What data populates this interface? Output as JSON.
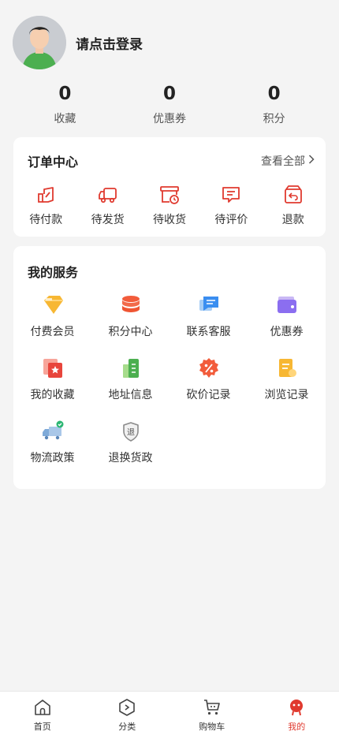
{
  "profile": {
    "login_text": "请点击登录"
  },
  "stats": [
    {
      "value": "0",
      "label": "收藏"
    },
    {
      "value": "0",
      "label": "优惠券"
    },
    {
      "value": "0",
      "label": "积分"
    }
  ],
  "orders": {
    "title": "订单中心",
    "view_all": "查看全部",
    "items": [
      {
        "label": "待付款",
        "icon": "pending-payment-icon"
      },
      {
        "label": "待发货",
        "icon": "truck-icon"
      },
      {
        "label": "待收货",
        "icon": "box-clock-icon"
      },
      {
        "label": "待评价",
        "icon": "comment-icon"
      },
      {
        "label": "退款",
        "icon": "refund-icon"
      }
    ]
  },
  "services": {
    "title": "我的服务",
    "items": [
      {
        "label": "付费会员",
        "icon": "diamond-icon"
      },
      {
        "label": "积分中心",
        "icon": "coins-stack-icon"
      },
      {
        "label": "联系客服",
        "icon": "chat-bubble-icon"
      },
      {
        "label": "优惠券",
        "icon": "wallet-icon"
      },
      {
        "label": "我的收藏",
        "icon": "star-card-icon"
      },
      {
        "label": "地址信息",
        "icon": "building-icon"
      },
      {
        "label": "砍价记录",
        "icon": "discount-badge-icon"
      },
      {
        "label": "浏览记录",
        "icon": "document-icon"
      },
      {
        "label": "物流政策",
        "icon": "delivery-truck-icon"
      },
      {
        "label": "退换货政",
        "icon": "return-shield-icon"
      }
    ]
  },
  "tabbar": [
    {
      "label": "首页",
      "icon": "home-icon"
    },
    {
      "label": "分类",
      "icon": "category-icon"
    },
    {
      "label": "购物车",
      "icon": "cart-icon"
    },
    {
      "label": "我的",
      "icon": "profile-icon",
      "active": true
    }
  ],
  "colors": {
    "accent": "#e03a2f",
    "background": "#f4f4f4"
  }
}
